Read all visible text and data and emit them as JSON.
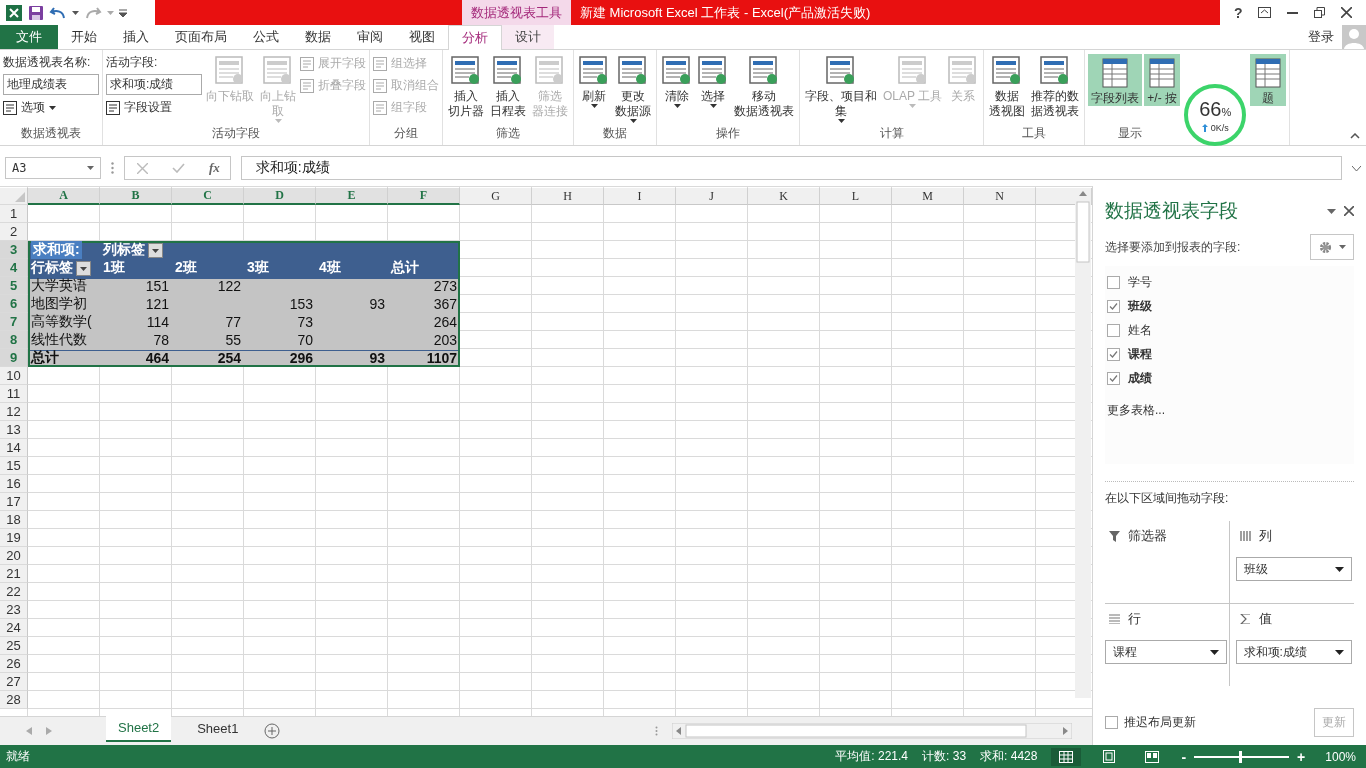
{
  "title_bar": {
    "context_tab": "数据透视表工具",
    "title": "新建 Microsoft Excel 工作表 -  Excel(产品激活失败)",
    "help": "?"
  },
  "ribbon_tabs": [
    {
      "label": "文件",
      "kind": "file",
      "selected": false
    },
    {
      "label": "开始",
      "kind": "normal",
      "selected": false
    },
    {
      "label": "插入",
      "kind": "normal",
      "selected": false
    },
    {
      "label": "页面布局",
      "kind": "normal",
      "selected": false
    },
    {
      "label": "公式",
      "kind": "normal",
      "selected": false
    },
    {
      "label": "数据",
      "kind": "normal",
      "selected": false
    },
    {
      "label": "审阅",
      "kind": "normal",
      "selected": false
    },
    {
      "label": "视图",
      "kind": "normal",
      "selected": false
    },
    {
      "label": "分析",
      "kind": "context",
      "selected": true
    },
    {
      "label": "设计",
      "kind": "context",
      "selected": false
    }
  ],
  "account": {
    "label": "登录"
  },
  "ribbon_groups": [
    {
      "label": "数据透视表",
      "columns": [
        [
          {
            "kind": "caption",
            "lines": [
              "数据透视表名称:"
            ]
          },
          {
            "kind": "field",
            "lines": [
              "地理成绩表"
            ]
          },
          {
            "kind": "small",
            "lines": [
              "选项"
            ],
            "dropdown": true,
            "disabled": false
          }
        ]
      ]
    },
    {
      "label": "活动字段",
      "columns": [
        [
          {
            "kind": "caption",
            "lines": [
              "活动字段:"
            ]
          },
          {
            "kind": "field",
            "lines": [
              "求和项:成绩"
            ]
          },
          {
            "kind": "small",
            "lines": [
              "字段设置"
            ],
            "dropdown": false,
            "disabled": false
          }
        ],
        [
          {
            "kind": "large",
            "lines": [
              "向下钻取"
            ],
            "dropdown": false,
            "disabled": true
          }
        ],
        [
          {
            "kind": "large",
            "lines": [
              "向上钻",
              "取"
            ],
            "dropdown": true,
            "disabled": true
          }
        ],
        [
          {
            "kind": "small",
            "lines": [
              "展开字段"
            ],
            "dropdown": false,
            "disabled": true
          },
          {
            "kind": "small",
            "lines": [
              "折叠字段"
            ],
            "dropdown": false,
            "disabled": true
          }
        ]
      ]
    },
    {
      "label": "分组",
      "columns": [
        [
          {
            "kind": "small",
            "lines": [
              "组选择"
            ],
            "dropdown": false,
            "disabled": true
          },
          {
            "kind": "small",
            "lines": [
              "取消组合"
            ],
            "dropdown": false,
            "disabled": true
          },
          {
            "kind": "small",
            "lines": [
              "组字段"
            ],
            "dropdown": false,
            "disabled": true
          }
        ]
      ]
    },
    {
      "label": "筛选",
      "columns": [
        [
          {
            "kind": "large",
            "lines": [
              "插入",
              "切片器"
            ],
            "dropdown": false,
            "disabled": false
          }
        ],
        [
          {
            "kind": "large",
            "lines": [
              "插入",
              "日程表"
            ],
            "dropdown": false,
            "disabled": false
          }
        ],
        [
          {
            "kind": "large",
            "lines": [
              "筛选",
              "器连接"
            ],
            "dropdown": false,
            "disabled": true
          }
        ]
      ]
    },
    {
      "label": "数据",
      "columns": [
        [
          {
            "kind": "large",
            "lines": [
              "刷新"
            ],
            "dropdown": true,
            "disabled": false
          }
        ],
        [
          {
            "kind": "large",
            "lines": [
              "更改",
              "数据源"
            ],
            "dropdown": true,
            "disabled": false
          }
        ]
      ]
    },
    {
      "label": "操作",
      "columns": [
        [
          {
            "kind": "large",
            "lines": [
              "清除"
            ],
            "dropdown": true,
            "disabled": false
          }
        ],
        [
          {
            "kind": "large",
            "lines": [
              "选择"
            ],
            "dropdown": true,
            "disabled": false
          }
        ],
        [
          {
            "kind": "large",
            "lines": [
              "移动",
              "数据透视表"
            ],
            "dropdown": false,
            "disabled": false
          }
        ]
      ]
    },
    {
      "label": "计算",
      "columns": [
        [
          {
            "kind": "large",
            "lines": [
              "字段、项目和",
              "集"
            ],
            "dropdown": true,
            "disabled": false
          }
        ],
        [
          {
            "kind": "large",
            "lines": [
              "OLAP 工具"
            ],
            "dropdown": true,
            "disabled": true
          }
        ],
        [
          {
            "kind": "large",
            "lines": [
              "关系"
            ],
            "dropdown": false,
            "disabled": true
          }
        ]
      ]
    },
    {
      "label": "工具",
      "columns": [
        [
          {
            "kind": "large",
            "lines": [
              "数据",
              "透视图"
            ],
            "dropdown": false,
            "disabled": false
          }
        ],
        [
          {
            "kind": "large",
            "lines": [
              "推荐的数",
              "据透视表"
            ],
            "dropdown": false,
            "disabled": false
          }
        ]
      ]
    },
    {
      "label": "显示",
      "columns": [
        [
          {
            "kind": "toggle",
            "lines": [
              "字段列表"
            ],
            "selected": true
          }
        ],
        [
          {
            "kind": "toggle",
            "lines": [
              "+/- 按"
            ],
            "selected": true
          }
        ],
        [
          {
            "kind": "toggle",
            "lines": [
              "题"
            ],
            "selected": true
          }
        ]
      ]
    }
  ],
  "speed_meter": {
    "percent": "66",
    "unit": "%",
    "rate": "0K/s"
  },
  "formula_bar": {
    "name_box": "A3",
    "fx": "fx",
    "value": "求和项:成绩"
  },
  "sheet": {
    "columns": [
      {
        "label": "A",
        "selected": true
      },
      {
        "label": "B",
        "selected": true
      },
      {
        "label": "C",
        "selected": true
      },
      {
        "label": "D",
        "selected": true
      },
      {
        "label": "E",
        "selected": true
      },
      {
        "label": "F",
        "selected": true
      },
      {
        "label": "G",
        "selected": false
      },
      {
        "label": "H",
        "selected": false
      },
      {
        "label": "I",
        "selected": false
      },
      {
        "label": "J",
        "selected": false
      },
      {
        "label": "K",
        "selected": false
      },
      {
        "label": "L",
        "selected": false
      },
      {
        "label": "M",
        "selected": false
      },
      {
        "label": "N",
        "selected": false
      }
    ],
    "rows": [
      {
        "label": "1",
        "selected": false
      },
      {
        "label": "2",
        "selected": false
      },
      {
        "label": "3",
        "selected": true
      },
      {
        "label": "4",
        "selected": true
      },
      {
        "label": "5",
        "selected": true
      },
      {
        "label": "6",
        "selected": true
      },
      {
        "label": "7",
        "selected": true
      },
      {
        "label": "8",
        "selected": true
      },
      {
        "label": "9",
        "selected": true
      },
      {
        "label": "10",
        "selected": false
      },
      {
        "label": "11",
        "selected": false
      },
      {
        "label": "12",
        "selected": false
      },
      {
        "label": "13",
        "selected": false
      },
      {
        "label": "14",
        "selected": false
      },
      {
        "label": "15",
        "selected": false
      },
      {
        "label": "16",
        "selected": false
      },
      {
        "label": "17",
        "selected": false
      },
      {
        "label": "18",
        "selected": false
      },
      {
        "label": "19",
        "selected": false
      },
      {
        "label": "20",
        "selected": false
      },
      {
        "label": "21",
        "selected": false
      },
      {
        "label": "22",
        "selected": false
      },
      {
        "label": "23",
        "selected": false
      },
      {
        "label": "24",
        "selected": false
      },
      {
        "label": "25",
        "selected": false
      },
      {
        "label": "26",
        "selected": false
      },
      {
        "label": "27",
        "selected": false
      },
      {
        "label": "28",
        "selected": false
      }
    ]
  },
  "pivot": {
    "data_label": "求和项:",
    "col_label": "列标签",
    "row_label": "行标签",
    "columns": [
      "1班",
      "2班",
      "3班",
      "4班",
      "总计"
    ],
    "rows": [
      {
        "label": "大学英语",
        "values": {
          "1班": "151",
          "2班": "122",
          "总计": "273"
        }
      },
      {
        "label": "地图学初",
        "values": {
          "1班": "121",
          "3班": "153",
          "4班": "93",
          "总计": "367"
        }
      },
      {
        "label": "高等数学(",
        "values": {
          "1班": "114",
          "2班": "77",
          "3班": "73",
          "总计": "264"
        }
      },
      {
        "label": "线性代数",
        "values": {
          "1班": "78",
          "2班": "55",
          "3班": "70",
          "总计": "203"
        }
      }
    ],
    "total": {
      "label": "总计",
      "values": {
        "1班": "464",
        "2班": "254",
        "3班": "296",
        "4班": "93",
        "总计": "1107"
      }
    }
  },
  "sheet_tabs": [
    {
      "label": "Sheet2",
      "selected": true
    },
    {
      "label": "Sheet1",
      "selected": false
    }
  ],
  "status_bar": {
    "ready": "就绪",
    "average": "平均值: 221.4",
    "count": "计数: 33",
    "sum": "求和: 4428",
    "zoom": {
      "minus": "-",
      "plus": "+",
      "level": 0.47,
      "reading": "100%"
    }
  },
  "field_pane": {
    "title": "数据透视表字段",
    "subtitle": "选择要添加到报表的字段:",
    "fields": [
      {
        "label": "学号",
        "checked": false
      },
      {
        "label": "班级",
        "checked": true
      },
      {
        "label": "姓名",
        "checked": false
      },
      {
        "label": "课程",
        "checked": true
      },
      {
        "label": "成绩",
        "checked": true
      }
    ],
    "more_tables": "更多表格...",
    "areas_caption": "在以下区域间拖动字段:",
    "areas": [
      {
        "kind": "filter",
        "label": "筛选器"
      },
      {
        "kind": "columns",
        "label": "列",
        "items": [
          "班级"
        ]
      },
      {
        "kind": "rows",
        "label": "行",
        "items": [
          "课程"
        ]
      },
      {
        "kind": "values",
        "label": "值",
        "items": [
          "求和项:成绩"
        ]
      }
    ],
    "defer": {
      "label": "推迟布局更新",
      "checked": false
    },
    "update_button": {
      "label": "更新",
      "disabled": true
    }
  }
}
